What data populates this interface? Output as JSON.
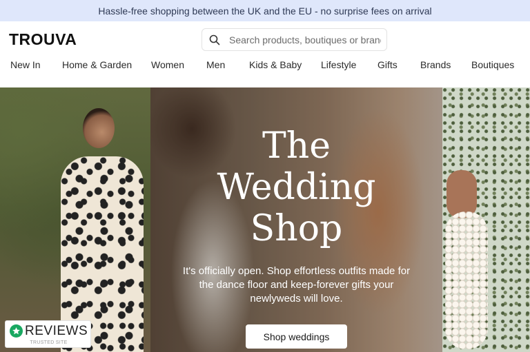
{
  "announcement": "Hassle-free shopping between the UK and the EU - no surprise fees on arrival",
  "header": {
    "logo": "TROUVA",
    "search": {
      "placeholder": "Search products, boutiques or brands",
      "icon": "search-icon"
    }
  },
  "nav": {
    "items": [
      {
        "label": "New In"
      },
      {
        "label": "Home & Garden"
      },
      {
        "label": "Women"
      },
      {
        "label": "Men"
      },
      {
        "label": "Kids & Baby"
      },
      {
        "label": "Lifestyle"
      },
      {
        "label": "Gifts"
      },
      {
        "label": "Brands"
      },
      {
        "label": "Boutiques"
      }
    ]
  },
  "hero": {
    "title_line1": "The",
    "title_line2": "Wedding",
    "title_line3": "Shop",
    "subtitle": "It's officially open. Shop effortless outfits made for the dance floor and keep-forever gifts your newlyweds will love.",
    "cta": "Shop weddings"
  },
  "reviews_badge": {
    "label": "REVIEWS",
    "sub": "TRUSTED SITE",
    "icon": "star-icon",
    "color": "#19a861"
  },
  "colors": {
    "announcement_bg": "#dfe7fb",
    "text": "#1a1a1a"
  }
}
